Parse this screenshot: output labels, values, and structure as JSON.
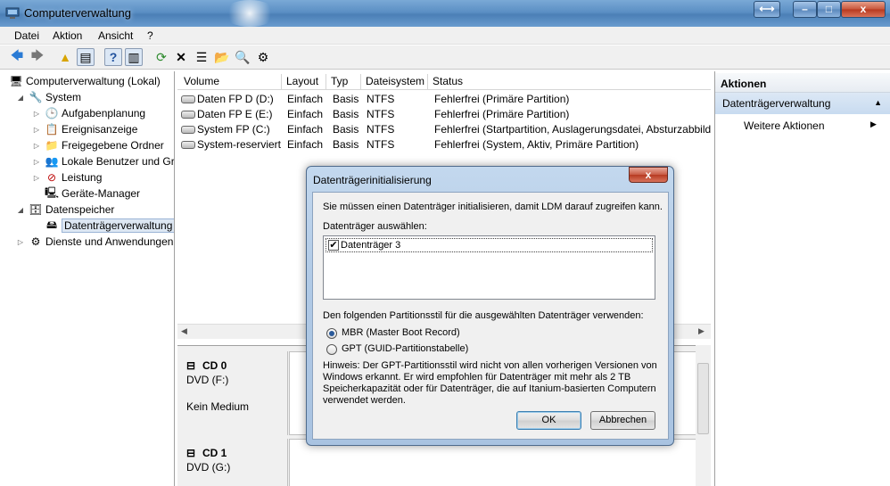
{
  "window": {
    "title": "Computerverwaltung"
  },
  "menu": [
    "Datei",
    "Aktion",
    "Ansicht",
    "?"
  ],
  "tree": [
    {
      "label": "Computerverwaltung (Lokal)",
      "icon": "computer-icon",
      "level": 0,
      "arrow": ""
    },
    {
      "label": "System",
      "icon": "tools-icon",
      "level": 1,
      "arrow": "expanded"
    },
    {
      "label": "Aufgabenplanung",
      "icon": "clock-icon",
      "level": 2,
      "arrow": "collapsed"
    },
    {
      "label": "Ereignisanzeige",
      "icon": "event-viewer-icon",
      "level": 2,
      "arrow": "collapsed"
    },
    {
      "label": "Freigegebene Ordner",
      "icon": "shared-folder-icon",
      "level": 2,
      "arrow": "collapsed"
    },
    {
      "label": "Lokale Benutzer und Gr",
      "icon": "users-icon",
      "level": 2,
      "arrow": "collapsed"
    },
    {
      "label": "Leistung",
      "icon": "performance-icon",
      "level": 2,
      "arrow": "collapsed"
    },
    {
      "label": "Geräte-Manager",
      "icon": "device-manager-icon",
      "level": 2,
      "arrow": ""
    },
    {
      "label": "Datenspeicher",
      "icon": "storage-icon",
      "level": 1,
      "arrow": "expanded"
    },
    {
      "label": "Datenträgerverwaltung",
      "icon": "disk-management-icon",
      "level": 2,
      "arrow": "",
      "selected": true
    },
    {
      "label": "Dienste und Anwendungen",
      "icon": "services-icon",
      "level": 1,
      "arrow": "collapsed"
    }
  ],
  "volumes": {
    "columns": [
      "Volume",
      "Layout",
      "Typ",
      "Dateisystem",
      "Status"
    ],
    "rows": [
      [
        "Daten FP D (D:)",
        "Einfach",
        "Basis",
        "NTFS",
        "Fehlerfrei (Primäre Partition)"
      ],
      [
        "Daten FP E (E:)",
        "Einfach",
        "Basis",
        "NTFS",
        "Fehlerfrei (Primäre Partition)"
      ],
      [
        "System FP (C:)",
        "Einfach",
        "Basis",
        "NTFS",
        "Fehlerfrei (Startpartition, Auslagerungsdatei, Absturzabbild"
      ],
      [
        "System-reserviert",
        "Einfach",
        "Basis",
        "NTFS",
        "Fehlerfrei (System, Aktiv, Primäre Partition)"
      ]
    ]
  },
  "disks": [
    {
      "name": "CD 0",
      "type": "DVD (F:)",
      "status": "Kein Medium"
    },
    {
      "name": "CD 1",
      "type": "DVD (G:)",
      "status": ""
    }
  ],
  "actions": {
    "header": "Aktionen",
    "section": "Datenträgerverwaltung",
    "more": "Weitere Aktionen"
  },
  "dialog": {
    "title": "Datenträgerinitialisierung",
    "intro": "Sie müssen einen Datenträger initialisieren, damit LDM darauf zugreifen kann.",
    "select_label": "Datenträger auswählen:",
    "disk_item": "Datenträger 3",
    "style_label": "Den folgenden Partitionsstil für die ausgewählten Datenträger verwenden:",
    "mbr": "MBR (Master Boot Record)",
    "gpt": "GPT (GUID-Partitionstabelle)",
    "hint": [
      "Hinweis: Der GPT-Partitionsstil wird nicht von allen vorherigen Versionen von",
      "Windows erkannt. Er wird empfohlen für Datenträger mit mehr als 2 TB",
      "Speicherkapazität oder für Datenträger, die auf Itanium-basierten Computern",
      "verwendet werden."
    ],
    "ok": "OK",
    "cancel": "Abbrechen",
    "close": "x"
  },
  "titlebar_buttons": {
    "extra": "⟷",
    "minimize": "–",
    "maximize": "□",
    "close": "x"
  }
}
